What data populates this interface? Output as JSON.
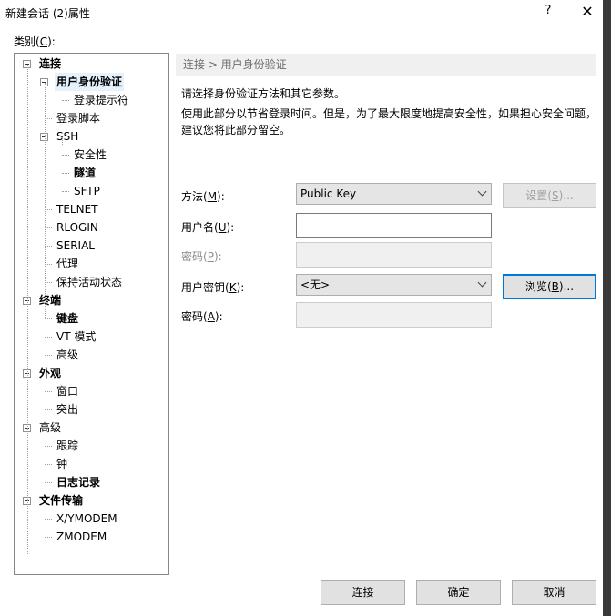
{
  "window": {
    "title": "新建会话 (2)属性",
    "help_glyph": "?",
    "close_glyph": "✕"
  },
  "category_label": {
    "pre": "类别(",
    "key": "C",
    "post": "):"
  },
  "tree": [
    {
      "label": "连接",
      "bold": true
    },
    {
      "label": "用户身份验证",
      "bold": true
    },
    {
      "label": "登录提示符",
      "bold": false
    },
    {
      "label": "登录脚本",
      "bold": false
    },
    {
      "label": "SSH",
      "bold": false
    },
    {
      "label": "安全性",
      "bold": false
    },
    {
      "label": "隧道",
      "bold": true
    },
    {
      "label": "SFTP",
      "bold": false
    },
    {
      "label": "TELNET",
      "bold": false
    },
    {
      "label": "RLOGIN",
      "bold": false
    },
    {
      "label": "SERIAL",
      "bold": false
    },
    {
      "label": "代理",
      "bold": false
    },
    {
      "label": "保持活动状态",
      "bold": false
    },
    {
      "label": "终端",
      "bold": true
    },
    {
      "label": "键盘",
      "bold": true
    },
    {
      "label": "VT 模式",
      "bold": false
    },
    {
      "label": "高级",
      "bold": false
    },
    {
      "label": "外观",
      "bold": true
    },
    {
      "label": "窗口",
      "bold": false
    },
    {
      "label": "突出",
      "bold": false
    },
    {
      "label": "高级",
      "bold": false
    },
    {
      "label": "跟踪",
      "bold": false
    },
    {
      "label": "钟",
      "bold": false
    },
    {
      "label": "日志记录",
      "bold": true
    },
    {
      "label": "文件传输",
      "bold": true
    },
    {
      "label": "X/YMODEM",
      "bold": false
    },
    {
      "label": "ZMODEM",
      "bold": false
    }
  ],
  "breadcrumb": "连接 > 用户身份验证",
  "desc1": "请选择身份验证方法和其它参数。",
  "desc2": "使用此部分以节省登录时间。但是，为了最大限度地提高安全性，如果担心安全问题，",
  "desc3": "建议您将此部分留空。",
  "form": {
    "method_label": {
      "pre": "方法(",
      "key": "M",
      "post": "):"
    },
    "method_value": "Public Key",
    "settings_button": {
      "pre": "设置(",
      "key": "S",
      "post": ")..."
    },
    "username_label": {
      "pre": "用户名(",
      "key": "U",
      "post": "):"
    },
    "username_value": "",
    "password_label": {
      "pre": "密码(",
      "key": "P",
      "post": "):"
    },
    "userkey_label": {
      "pre": "用户密钥(",
      "key": "K",
      "post": "):"
    },
    "userkey_value": "<无>",
    "browse_button": {
      "pre": "浏览(",
      "key": "B",
      "post": ")..."
    },
    "passphrase_label": {
      "pre": "密码(",
      "key": "A",
      "post": "):"
    }
  },
  "buttons": {
    "connect": "连接",
    "ok": "确定",
    "cancel": "取消"
  }
}
